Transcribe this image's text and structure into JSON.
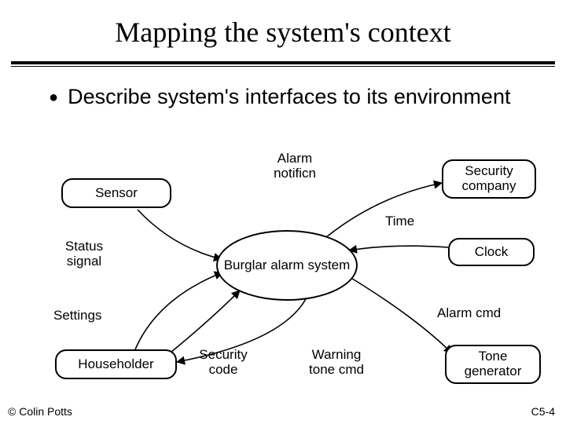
{
  "title": "Mapping the system's context",
  "bullet": "Describe system's interfaces to its environment",
  "center_node": "Burglar alarm system",
  "nodes": {
    "sensor": "Sensor",
    "security_company": "Security company",
    "clock": "Clock",
    "tone_generator": "Tone generator",
    "householder": "Householder"
  },
  "edges": {
    "alarm_notificn": "Alarm notificn",
    "time": "Time",
    "status_signal": "Status signal",
    "alarm_cmd": "Alarm cmd",
    "settings": "Settings",
    "security_code": "Security code",
    "warning_tone_cmd": "Warning tone cmd"
  },
  "footer": {
    "left": "© Colin Potts",
    "right": "C5-4"
  }
}
